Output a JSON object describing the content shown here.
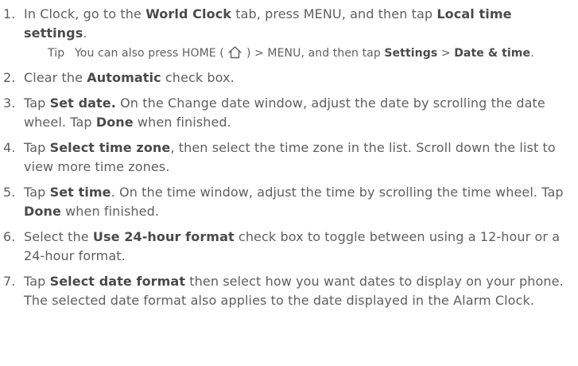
{
  "steps": [
    {
      "number": "1.",
      "parts": [
        "In Clock, go to the ",
        "World Clock",
        " tab, press MENU, and then tap ",
        "Local time settings",
        "."
      ],
      "tip": {
        "label": "Tip",
        "parts": [
          "You can also press HOME ( ",
          " ) > MENU, and then tap ",
          "Settings",
          " > ",
          "Date & time",
          "."
        ],
        "icon": "home-icon"
      }
    },
    {
      "number": "2.",
      "parts": [
        "Clear the ",
        "Automatic",
        " check box."
      ]
    },
    {
      "number": "3.",
      "parts": [
        "Tap ",
        "Set date",
        ".",
        " On the Change date window, adjust the date by scrolling the date wheel. Tap ",
        "Done",
        " when finished."
      ]
    },
    {
      "number": "4.",
      "parts": [
        "Tap ",
        "Select time zone",
        ", then select the time zone in the list. Scroll down the list to view more time zones."
      ]
    },
    {
      "number": "5.",
      "parts": [
        "Tap ",
        "Set time",
        ". On the time window, adjust the time by scrolling the time wheel. Tap ",
        "Done",
        " when finished."
      ]
    },
    {
      "number": "6.",
      "parts": [
        "Select the ",
        "Use 24-hour format",
        " check box to toggle between using a 12-hour or a 24-hour format."
      ]
    },
    {
      "number": "7.",
      "parts": [
        "Tap ",
        "Select date format",
        " then select how you want dates to display on your phone. The selected date format also applies to the date displayed in the Alarm Clock."
      ]
    }
  ]
}
